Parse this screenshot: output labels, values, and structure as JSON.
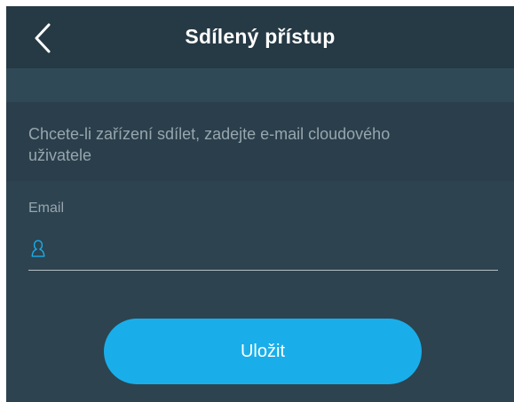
{
  "header": {
    "title": "Sdílený přístup",
    "back_icon": "chevron-left-icon"
  },
  "info": {
    "text": "Chcete-li zařízení sdílet, zadejte e-mail cloudového uživatele"
  },
  "form": {
    "email_label": "Email",
    "email_value": "",
    "email_placeholder": "",
    "user_icon": "user-outline-icon",
    "save_label": "Uložit"
  },
  "colors": {
    "accent": "#19aeea",
    "header_bg": "#263a45",
    "background": "#2d4350",
    "info_panel_bg": "#2a3f4b",
    "secondary_text": "#97a6ae"
  }
}
